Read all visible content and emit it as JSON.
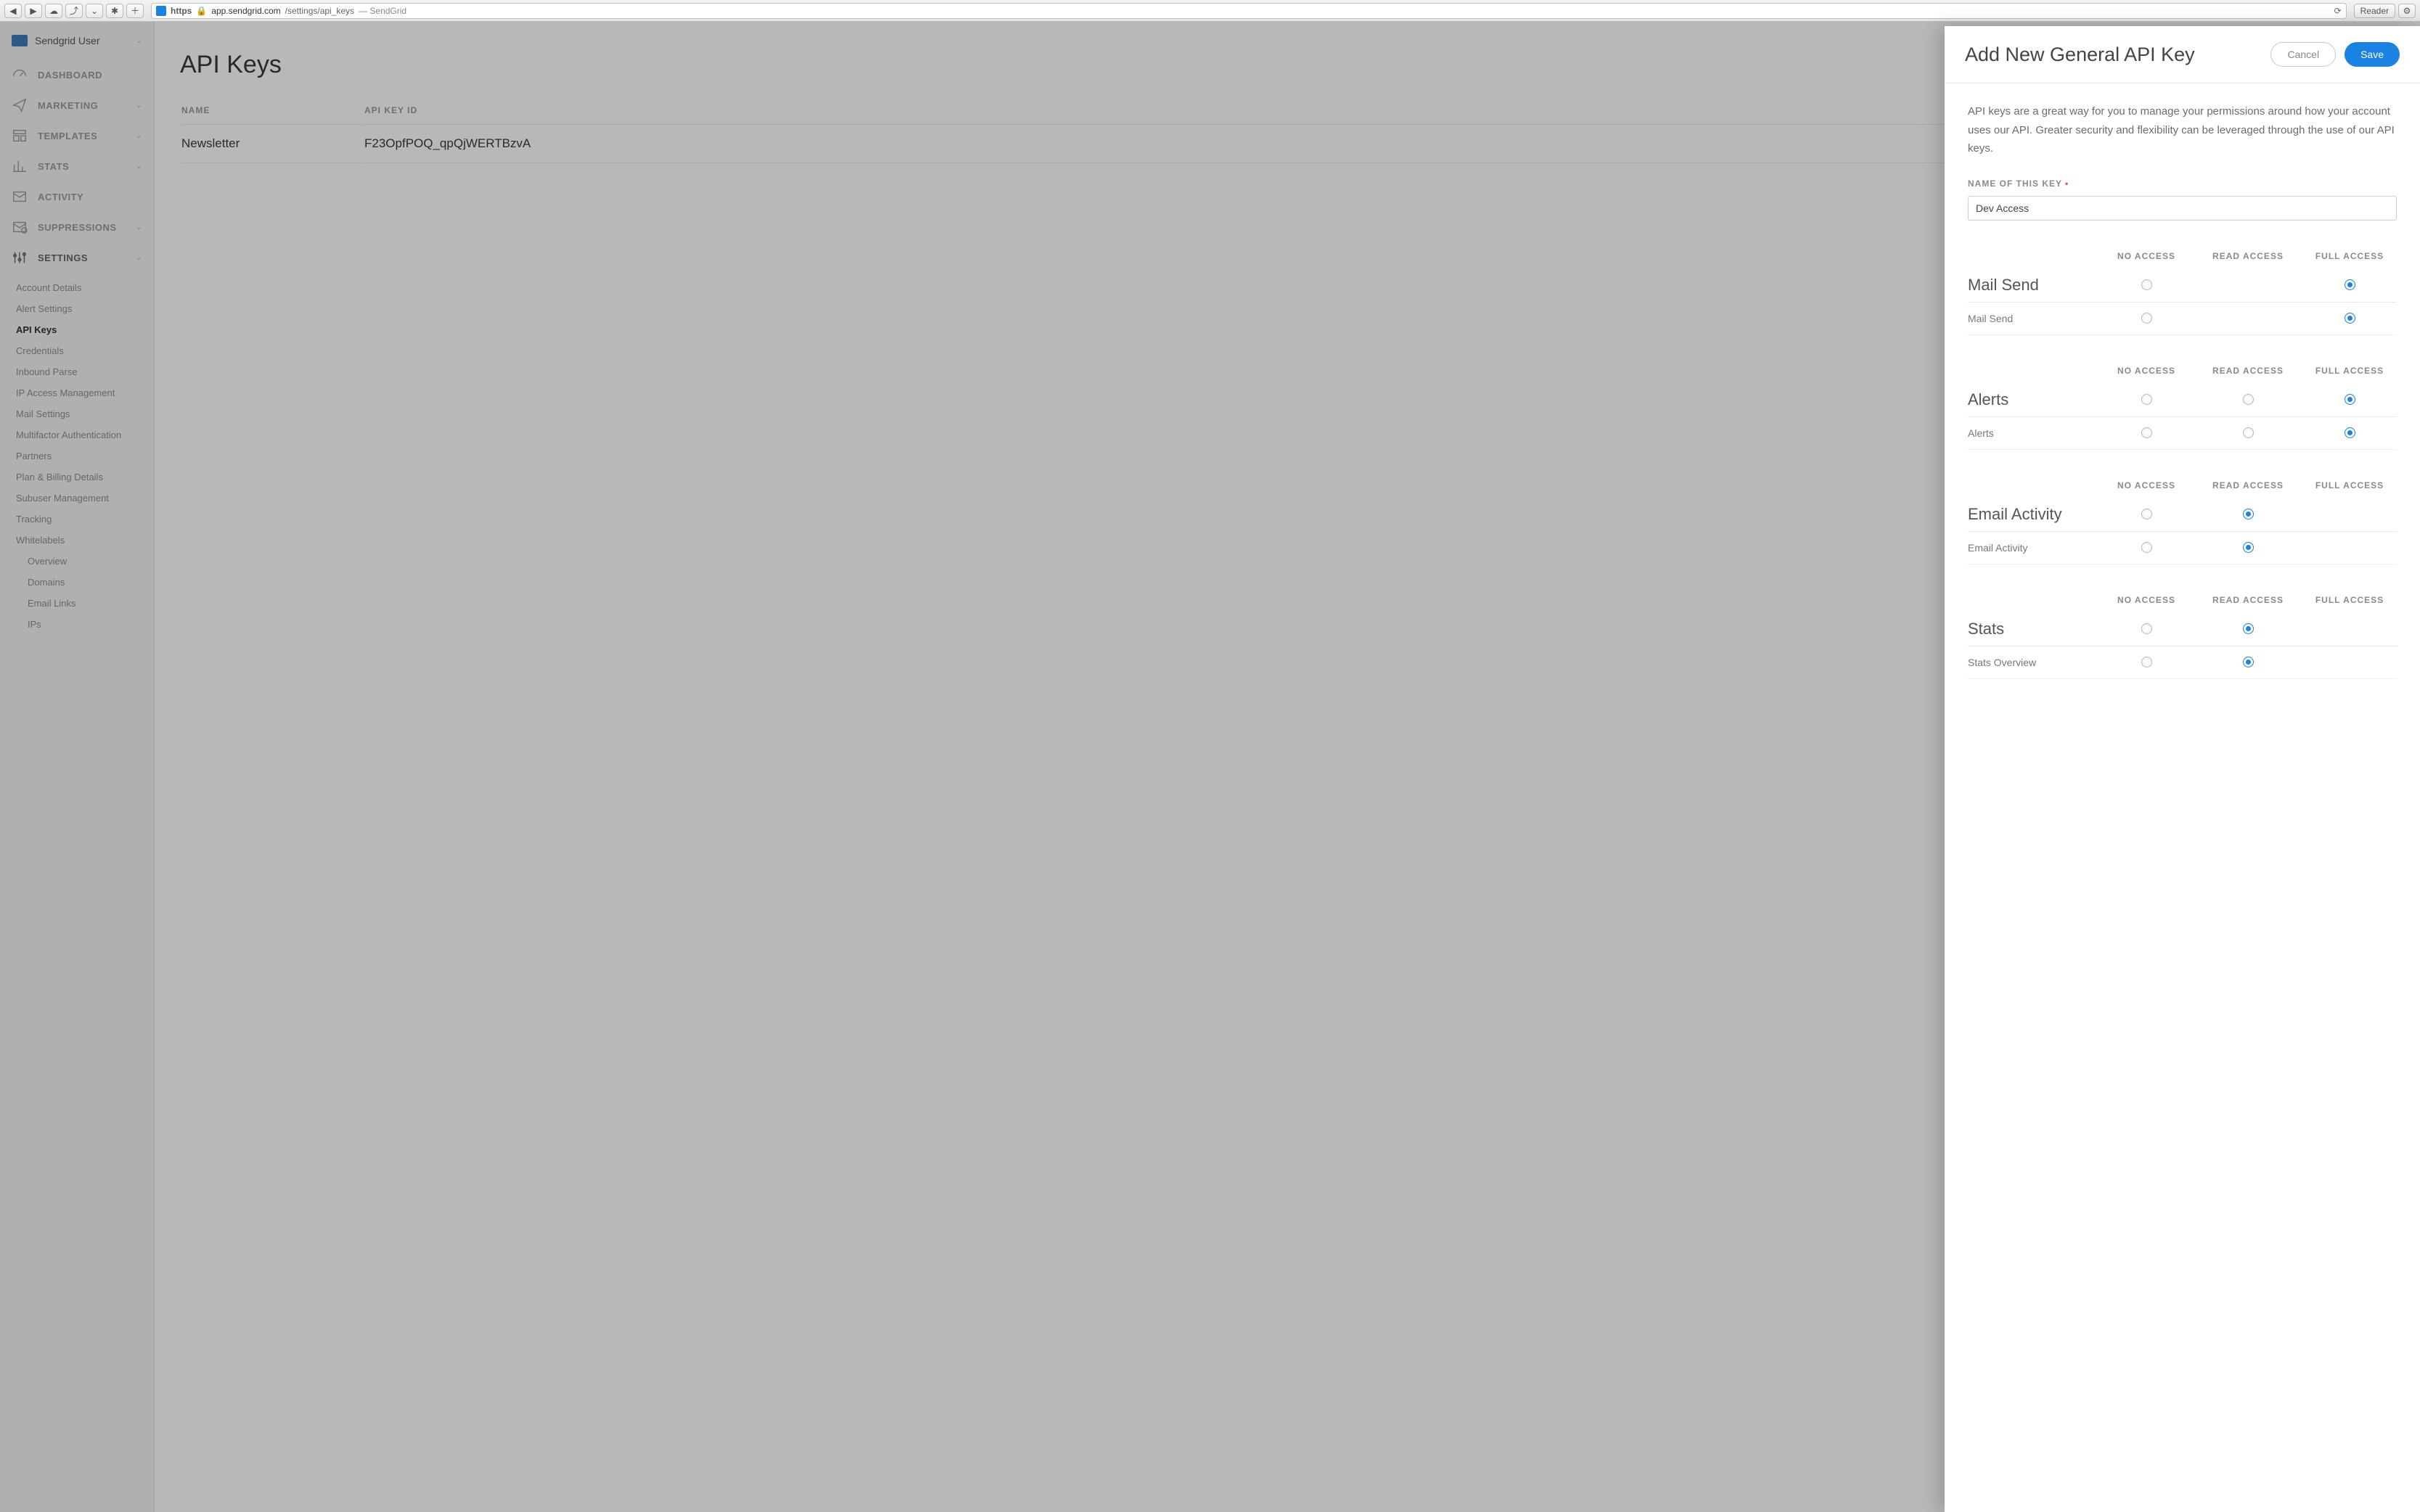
{
  "browser": {
    "url_https": "https",
    "url_host": "app.sendgrid.com",
    "url_path": "/settings/api_keys",
    "url_title": " — SendGrid",
    "reader": "Reader"
  },
  "user": {
    "name": "Sendgrid User"
  },
  "nav": [
    {
      "label": "DASHBOARD",
      "icon": "gauge"
    },
    {
      "label": "MARKETING",
      "icon": "send",
      "chev": true
    },
    {
      "label": "TEMPLATES",
      "icon": "templates",
      "chev": true
    },
    {
      "label": "STATS",
      "icon": "stats",
      "chev": true
    },
    {
      "label": "ACTIVITY",
      "icon": "mail"
    },
    {
      "label": "SUPPRESSIONS",
      "icon": "mailx",
      "chev": true
    },
    {
      "label": "SETTINGS",
      "icon": "sliders",
      "chev": true,
      "active": true
    }
  ],
  "settings_sub": [
    "Account Details",
    "Alert Settings",
    "API Keys",
    "Credentials",
    "Inbound Parse",
    "IP Access Management",
    "Mail Settings",
    "Multifactor Authentication",
    "Partners",
    "Plan & Billing Details",
    "Subuser Management",
    "Tracking",
    "Whitelabels"
  ],
  "settings_active": "API Keys",
  "whitelabel_sub": [
    "Overview",
    "Domains",
    "Email Links",
    "IPs"
  ],
  "page": {
    "title": "API Keys",
    "col_name": "NAME",
    "col_keyid": "API KEY ID",
    "rows": [
      {
        "name": "Newsletter",
        "key_id": "F23OpfPOQ_qpQjWERTBzvA"
      }
    ]
  },
  "drawer": {
    "title": "Add New General API Key",
    "cancel": "Cancel",
    "save": "Save",
    "help": "API keys are a great way for you to manage your permissions around how your account uses our API. Greater security and flexibility can be leveraged through the use of our API keys.",
    "name_label": "NAME OF THIS KEY",
    "name_value": "Dev Access",
    "col_no": "NO ACCESS",
    "col_read": "READ ACCESS",
    "col_full": "FULL ACCESS",
    "groups": [
      {
        "label": "Mail Send",
        "has_read": false,
        "selected": "full",
        "rows": [
          {
            "label": "Mail Send",
            "has_read": false,
            "selected": "full"
          }
        ]
      },
      {
        "label": "Alerts",
        "has_read": true,
        "selected": "full",
        "rows": [
          {
            "label": "Alerts",
            "has_read": true,
            "selected": "full"
          }
        ]
      },
      {
        "label": "Email Activity",
        "has_read": true,
        "has_full": false,
        "selected": "read",
        "rows": [
          {
            "label": "Email Activity",
            "has_read": true,
            "has_full": false,
            "selected": "read"
          }
        ]
      },
      {
        "label": "Stats",
        "has_read": true,
        "has_full": false,
        "selected": "read",
        "rows": [
          {
            "label": "Stats Overview",
            "has_read": true,
            "has_full": false,
            "selected": "read"
          }
        ]
      }
    ]
  }
}
